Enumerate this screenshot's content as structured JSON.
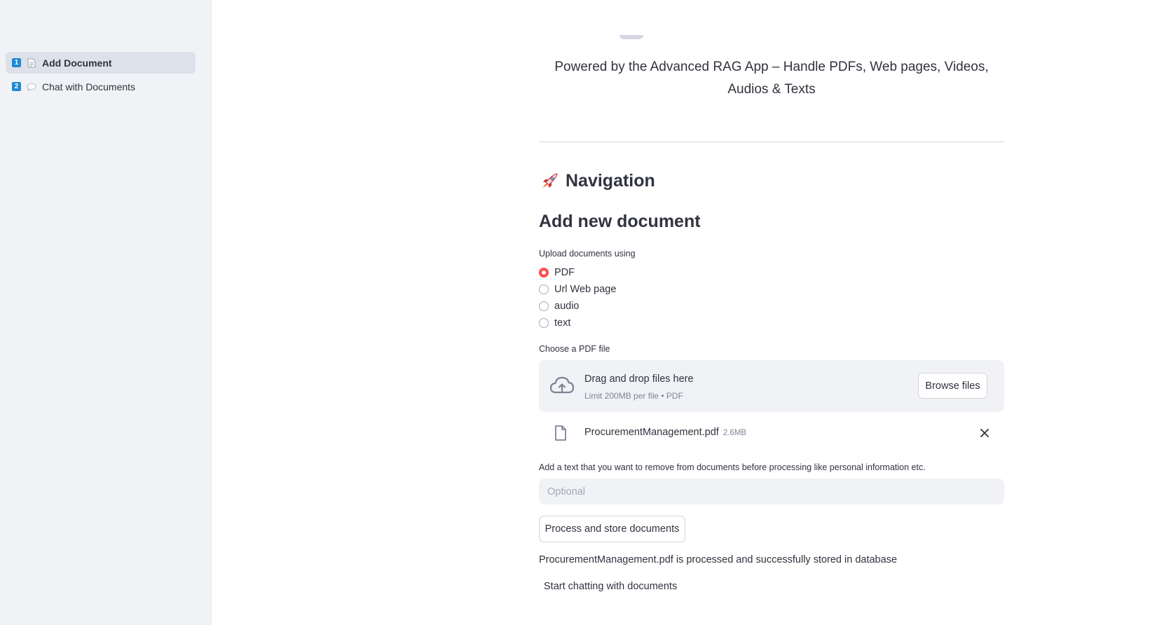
{
  "sidebar": {
    "items": [
      {
        "number": "1",
        "icon": "document-icon",
        "label": "Add Document",
        "active": true
      },
      {
        "number": "2",
        "icon": "speech-bubble-icon",
        "label": "Chat with Documents",
        "active": false
      }
    ]
  },
  "main": {
    "powered_by": "Powered by the Advanced RAG App – Handle PDFs, Web pages, Videos, Audios & Texts",
    "navigation_heading": "Navigation",
    "navigation_icon": "rocket-icon",
    "section_title": "Add new document",
    "upload_label": "Upload documents using",
    "upload_options": [
      {
        "label": "PDF",
        "checked": true
      },
      {
        "label": "Url Web page",
        "checked": false
      },
      {
        "label": "audio",
        "checked": false
      },
      {
        "label": "text",
        "checked": false
      }
    ],
    "file_label": "Choose a PDF file",
    "dropzone": {
      "title": "Drag and drop files here",
      "subtitle": "Limit 200MB per file • PDF",
      "browse_label": "Browse files",
      "icon": "cloud-upload-icon"
    },
    "uploaded_file": {
      "name": "ProcurementManagement.pdf",
      "size": "2.6MB",
      "icon": "file-icon"
    },
    "remove_text_label": "Add a text that you want to remove from documents before processing like personal information etc.",
    "remove_text_placeholder": "Optional",
    "process_button": "Process and store documents",
    "status_message": "ProcurementManagement.pdf is processed and successfully stored in database",
    "chat_link": "Start chatting with documents"
  },
  "colors": {
    "accent": "#ff4b4b",
    "sidebar_bg": "#f0f2f6",
    "nav_number_bg": "#1e8ad6",
    "text": "#31333f"
  }
}
